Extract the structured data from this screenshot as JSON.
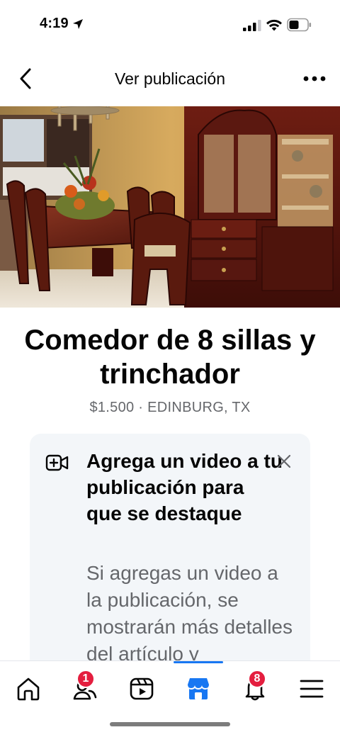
{
  "status_bar": {
    "time": "4:19",
    "icons": [
      "location-arrow-icon",
      "cellular-signal-icon",
      "wifi-icon",
      "battery-icon"
    ]
  },
  "nav": {
    "title": "Ver publicación",
    "back_icon": "chevron-left-icon",
    "more_icon": "more-dots-icon"
  },
  "listing": {
    "photo_icon": "dining-room-photo",
    "title": "Comedor de 8 sillas y trinchador",
    "meta": "$1.500 · EDINBURG, TX"
  },
  "promo": {
    "icon": "add-video-icon",
    "close_icon": "close-icon",
    "title": "Agrega un video a tu publicación para que se destaque",
    "body": "Si agregas un video a la publicación, se mostrarán más detalles del artículo y"
  },
  "tab_bar": {
    "active_color": "#1877f2",
    "badge_color": "#e41e3f",
    "tabs": [
      {
        "icon": "home-icon",
        "badge": ""
      },
      {
        "icon": "friends-icon",
        "badge": "1"
      },
      {
        "icon": "video-icon",
        "badge": ""
      },
      {
        "icon": "marketplace-icon",
        "badge": ""
      },
      {
        "icon": "notifications-bell-icon",
        "badge": "8"
      },
      {
        "icon": "menu-icon",
        "badge": ""
      }
    ]
  }
}
